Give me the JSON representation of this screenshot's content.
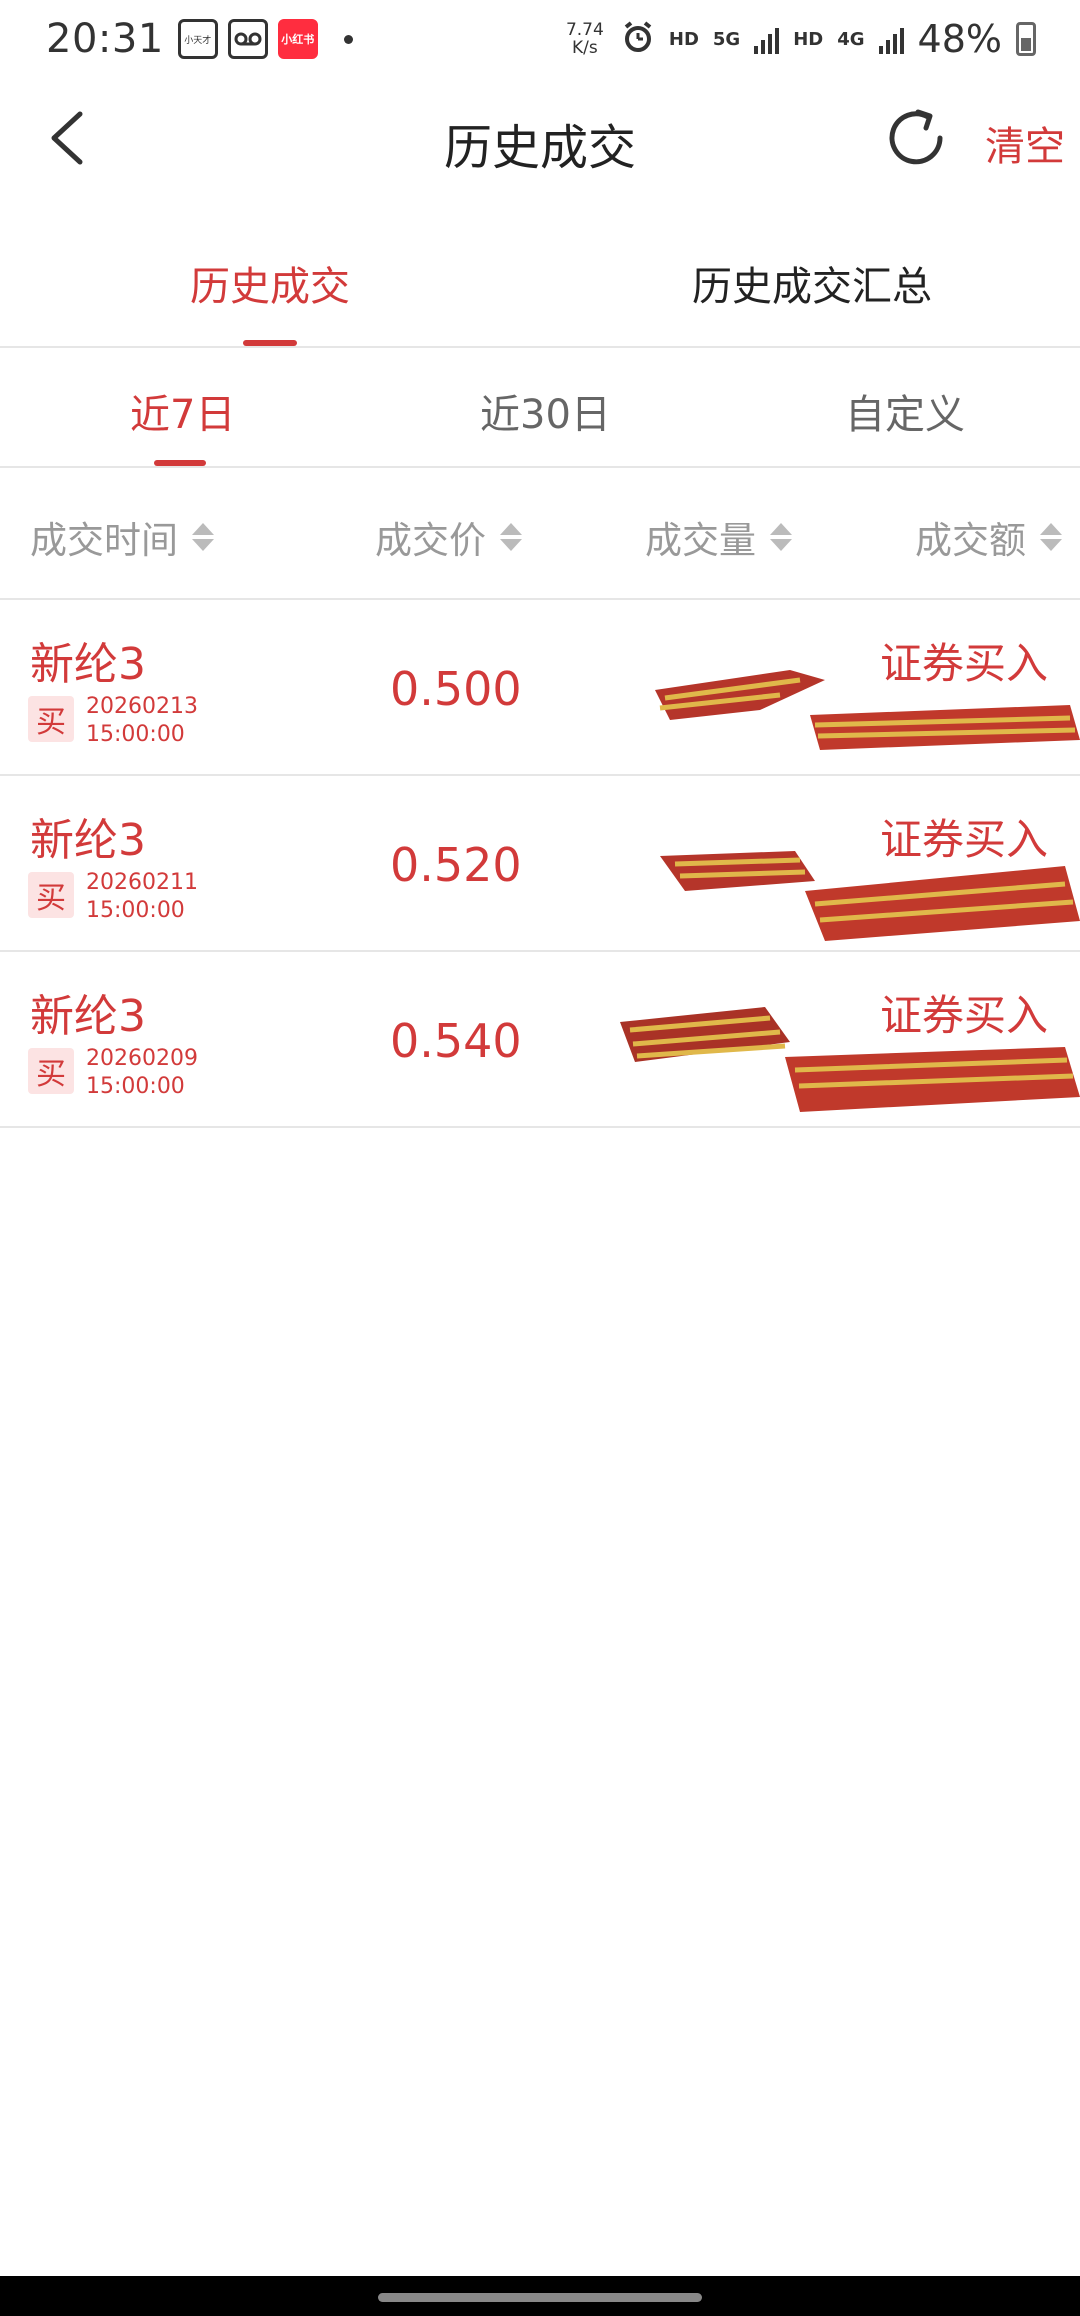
{
  "status_bar": {
    "time": "20:31",
    "app_icon_1": "小天才",
    "app_icon_3": "小红书",
    "net_speed_value": "7.74",
    "net_speed_unit": "K/s",
    "hd1": "HD",
    "net1": "5G",
    "hd2": "HD",
    "net2": "4G",
    "battery": "48%"
  },
  "nav": {
    "title": "历史成交",
    "clear_label": "清空"
  },
  "main_tabs": [
    {
      "label": "历史成交",
      "active": true
    },
    {
      "label": "历史成交汇总",
      "active": false
    }
  ],
  "period_tabs": [
    {
      "label": "近7日",
      "active": true
    },
    {
      "label": "近30日",
      "active": false
    },
    {
      "label": "自定义",
      "active": false
    }
  ],
  "columns": [
    "成交时间",
    "成交价",
    "成交量",
    "成交额"
  ],
  "rows": [
    {
      "name": "新纶3",
      "side": "买",
      "date": "20260213",
      "time": "15:00:00",
      "price": "0.500",
      "type": "证券买入"
    },
    {
      "name": "新纶3",
      "side": "买",
      "date": "20260211",
      "time": "15:00:00",
      "price": "0.520",
      "type": "证券买入"
    },
    {
      "name": "新纶3",
      "side": "买",
      "date": "20260209",
      "time": "15:00:00",
      "price": "0.540",
      "type": "证券买入"
    }
  ],
  "colors": {
    "accent": "#d23a3a",
    "badge_bg": "#fce3e3",
    "muted_text": "#999999",
    "divider": "#e6e6e6"
  }
}
